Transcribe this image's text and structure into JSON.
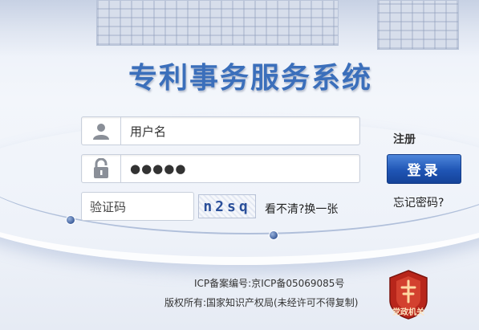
{
  "title": "专利事务服务系统",
  "form": {
    "username_placeholder": "用户名",
    "password_value": "●●●●●",
    "captcha_placeholder": "验证码",
    "captcha_code": "n2sq",
    "refresh_label": "看不清?换一张",
    "register_label": "注册",
    "login_label": "登录",
    "forgot_label": "忘记密码?"
  },
  "footer": {
    "icp": "ICP备案编号:京ICP备05069085号",
    "copyright": "版权所有:国家知识产权局(未经许可不得复制)",
    "emblem_label": "党政机关"
  },
  "colors": {
    "title": "#3b6fbb",
    "button": "#1f55b5",
    "emblem": "#b8261b"
  },
  "icons": {
    "user": "user-icon",
    "lock": "lock-icon"
  }
}
